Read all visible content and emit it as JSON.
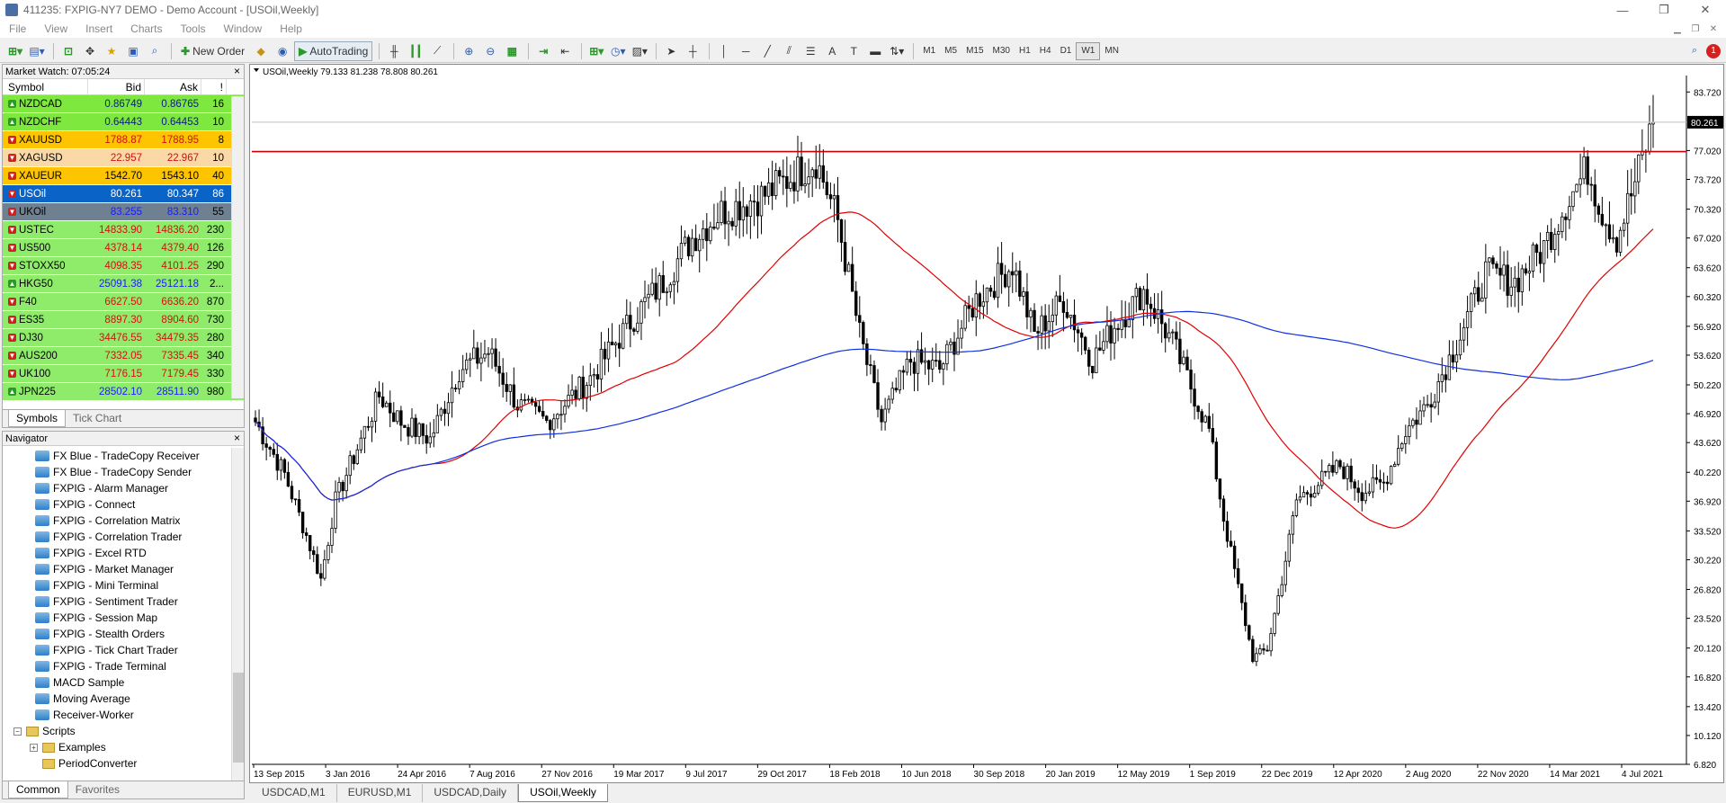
{
  "window": {
    "title": "411235: FXPIG-NY7 DEMO - Demo Account - [USOil,Weekly]",
    "controls": [
      "—",
      "❐",
      "✕"
    ]
  },
  "menu": [
    "File",
    "View",
    "Insert",
    "Charts",
    "Tools",
    "Window",
    "Help"
  ],
  "toolbar": {
    "new_order": "New Order",
    "autotrading": "AutoTrading",
    "timeframes": [
      "M1",
      "M5",
      "M15",
      "M30",
      "H1",
      "H4",
      "D1",
      "W1",
      "MN"
    ],
    "active_timeframe": "W1",
    "notification_count": "1"
  },
  "market_watch": {
    "title": "Market Watch: 07:05:24",
    "columns": [
      "Symbol",
      "Bid",
      "Ask",
      "!"
    ],
    "rows": [
      {
        "symbol": "NZDCAD",
        "bid": "0.86749",
        "ask": "0.86765",
        "spread": "16",
        "bg": "#7ee83f",
        "dir": "up",
        "text": "#0a1a80"
      },
      {
        "symbol": "NZDCHF",
        "bid": "0.64443",
        "ask": "0.64453",
        "spread": "10",
        "bg": "#7ee83f",
        "dir": "up",
        "text": "#0a1a80"
      },
      {
        "symbol": "XAUUSD",
        "bid": "1788.87",
        "ask": "1788.95",
        "spread": "8",
        "bg": "#ffc400",
        "dir": "down",
        "text": "#d01010"
      },
      {
        "symbol": "XAGUSD",
        "bid": "22.957",
        "ask": "22.967",
        "spread": "10",
        "bg": "#fbd9a7",
        "dir": "down",
        "text": "#d01010"
      },
      {
        "symbol": "XAUEUR",
        "bid": "1542.70",
        "ask": "1543.10",
        "spread": "40",
        "bg": "#ffc400",
        "dir": "down",
        "text": "#000000"
      },
      {
        "symbol": "USOil",
        "bid": "80.261",
        "ask": "80.347",
        "spread": "86",
        "bg": "#0a64c8",
        "dir": "down",
        "text": "#ffffff"
      },
      {
        "symbol": "UKOil",
        "bid": "83.255",
        "ask": "83.310",
        "spread": "55",
        "bg": "#6f8090",
        "dir": "down",
        "text": "#1a1aff"
      },
      {
        "symbol": "USTEC",
        "bid": "14833.90",
        "ask": "14836.20",
        "spread": "230",
        "bg": "#8fec6a",
        "dir": "down",
        "text": "#d01010"
      },
      {
        "symbol": "US500",
        "bid": "4378.14",
        "ask": "4379.40",
        "spread": "126",
        "bg": "#8fec6a",
        "dir": "down",
        "text": "#d01010"
      },
      {
        "symbol": "STOXX50",
        "bid": "4098.35",
        "ask": "4101.25",
        "spread": "290",
        "bg": "#8fec6a",
        "dir": "down",
        "text": "#d01010"
      },
      {
        "symbol": "HKG50",
        "bid": "25091.38",
        "ask": "25121.18",
        "spread": "2...",
        "bg": "#8fec6a",
        "dir": "up",
        "text": "#1a1aff"
      },
      {
        "symbol": "F40",
        "bid": "6627.50",
        "ask": "6636.20",
        "spread": "870",
        "bg": "#8fec6a",
        "dir": "down",
        "text": "#d01010"
      },
      {
        "symbol": "ES35",
        "bid": "8897.30",
        "ask": "8904.60",
        "spread": "730",
        "bg": "#8fec6a",
        "dir": "down",
        "text": "#d01010"
      },
      {
        "symbol": "DJ30",
        "bid": "34476.55",
        "ask": "34479.35",
        "spread": "280",
        "bg": "#8fec6a",
        "dir": "down",
        "text": "#d01010"
      },
      {
        "symbol": "AUS200",
        "bid": "7332.05",
        "ask": "7335.45",
        "spread": "340",
        "bg": "#8fec6a",
        "dir": "down",
        "text": "#d01010"
      },
      {
        "symbol": "UK100",
        "bid": "7176.15",
        "ask": "7179.45",
        "spread": "330",
        "bg": "#8fec6a",
        "dir": "down",
        "text": "#d01010"
      },
      {
        "symbol": "JPN225",
        "bid": "28502.10",
        "ask": "28511.90",
        "spread": "980",
        "bg": "#8fec6a",
        "dir": "up",
        "text": "#1a1aff"
      }
    ],
    "tabs": [
      "Symbols",
      "Tick Chart"
    ],
    "active_tab": "Symbols"
  },
  "navigator": {
    "title": "Navigator",
    "items": [
      {
        "label": "FX Blue - TradeCopy Receiver",
        "type": "ea",
        "indent": 1
      },
      {
        "label": "FX Blue - TradeCopy Sender",
        "type": "ea",
        "indent": 1
      },
      {
        "label": "FXPIG - Alarm Manager",
        "type": "ea",
        "indent": 1
      },
      {
        "label": "FXPIG - Connect",
        "type": "ea",
        "indent": 1
      },
      {
        "label": "FXPIG - Correlation Matrix",
        "type": "ea",
        "indent": 1
      },
      {
        "label": "FXPIG - Correlation Trader",
        "type": "ea",
        "indent": 1
      },
      {
        "label": "FXPIG - Excel RTD",
        "type": "ea",
        "indent": 1
      },
      {
        "label": "FXPIG - Market Manager",
        "type": "ea",
        "indent": 1
      },
      {
        "label": "FXPIG - Mini Terminal",
        "type": "ea",
        "indent": 1
      },
      {
        "label": "FXPIG - Sentiment Trader",
        "type": "ea",
        "indent": 1
      },
      {
        "label": "FXPIG - Session Map",
        "type": "ea",
        "indent": 1
      },
      {
        "label": "FXPIG - Stealth Orders",
        "type": "ea",
        "indent": 1
      },
      {
        "label": "FXPIG - Tick Chart Trader",
        "type": "ea",
        "indent": 1
      },
      {
        "label": "FXPIG - Trade Terminal",
        "type": "ea",
        "indent": 1
      },
      {
        "label": "MACD Sample",
        "type": "ea",
        "indent": 1
      },
      {
        "label": "Moving Average",
        "type": "ea",
        "indent": 1
      },
      {
        "label": "Receiver-Worker",
        "type": "ea",
        "indent": 1
      },
      {
        "label": "Scripts",
        "type": "folder",
        "indent": 0
      },
      {
        "label": "Examples",
        "type": "folder",
        "indent": 1
      },
      {
        "label": "PeriodConverter",
        "type": "folder",
        "indent": 1
      }
    ],
    "tabs": [
      "Common",
      "Favorites"
    ],
    "active_tab": "Common"
  },
  "chart": {
    "header": "USOil,Weekly  79.133 81.238 78.808 80.261",
    "price_levels": [
      "83.720",
      "80.261",
      "77.020",
      "73.720",
      "70.320",
      "67.020",
      "63.620",
      "60.320",
      "56.920",
      "53.620",
      "50.220",
      "46.920",
      "43.620",
      "40.220",
      "36.920",
      "33.520",
      "30.220",
      "26.820",
      "23.520",
      "20.120",
      "16.820",
      "13.420",
      "10.120",
      "6.820"
    ],
    "current_price": "80.261",
    "dates": [
      "13 Sep 2015",
      "3 Jan 2016",
      "24 Apr 2016",
      "7 Aug 2016",
      "27 Nov 2016",
      "19 Mar 2017",
      "9 Jul 2017",
      "29 Oct 2017",
      "18 Feb 2018",
      "10 Jun 2018",
      "30 Sep 2018",
      "20 Jan 2019",
      "12 May 2019",
      "1 Sep 2019",
      "22 Dec 2019",
      "12 Apr 2020",
      "2 Aug 2020",
      "22 Nov 2020",
      "14 Mar 2021",
      "4 Jul 2021"
    ],
    "horizontal_line_price": 76.9,
    "colors": {
      "candle": "#000000",
      "ma_fast": "#e00000",
      "ma_slow": "#1030e0",
      "hline": "#cc0000"
    }
  },
  "chart_tabs": [
    "USDCAD,M1",
    "EURUSD,M1",
    "USDCAD,Daily",
    "USOil,Weekly"
  ],
  "active_chart_tab": "USOil,Weekly",
  "chart_data": {
    "type": "candlestick",
    "title": "USOil,Weekly",
    "ylim": [
      6.82,
      85.6
    ],
    "anchors_close": [
      [
        0,
        46
      ],
      [
        8,
        40
      ],
      [
        14,
        33
      ],
      [
        18,
        28
      ],
      [
        22,
        37
      ],
      [
        30,
        45
      ],
      [
        34,
        49
      ],
      [
        40,
        46
      ],
      [
        48,
        44
      ],
      [
        56,
        52
      ],
      [
        64,
        54
      ],
      [
        72,
        48
      ],
      [
        80,
        46
      ],
      [
        92,
        51
      ],
      [
        104,
        58
      ],
      [
        112,
        62
      ],
      [
        120,
        67
      ],
      [
        128,
        70
      ],
      [
        140,
        72
      ],
      [
        154,
        76
      ],
      [
        160,
        69
      ],
      [
        166,
        56
      ],
      [
        172,
        46
      ],
      [
        180,
        53
      ],
      [
        188,
        52
      ],
      [
        198,
        60
      ],
      [
        208,
        64
      ],
      [
        214,
        56
      ],
      [
        222,
        60
      ],
      [
        230,
        53
      ],
      [
        236,
        57
      ],
      [
        244,
        61
      ],
      [
        252,
        55
      ],
      [
        258,
        49
      ],
      [
        262,
        45
      ],
      [
        266,
        35
      ],
      [
        270,
        27
      ],
      [
        274,
        19
      ],
      [
        278,
        20
      ],
      [
        282,
        28
      ],
      [
        286,
        37
      ],
      [
        292,
        39
      ],
      [
        298,
        41
      ],
      [
        304,
        38
      ],
      [
        310,
        39
      ],
      [
        316,
        45
      ],
      [
        322,
        48
      ],
      [
        330,
        55
      ],
      [
        338,
        63
      ],
      [
        346,
        62
      ],
      [
        354,
        66
      ],
      [
        360,
        71
      ],
      [
        366,
        75
      ],
      [
        370,
        70
      ],
      [
        374,
        67
      ],
      [
        378,
        72
      ],
      [
        384,
        80.3
      ]
    ]
  }
}
